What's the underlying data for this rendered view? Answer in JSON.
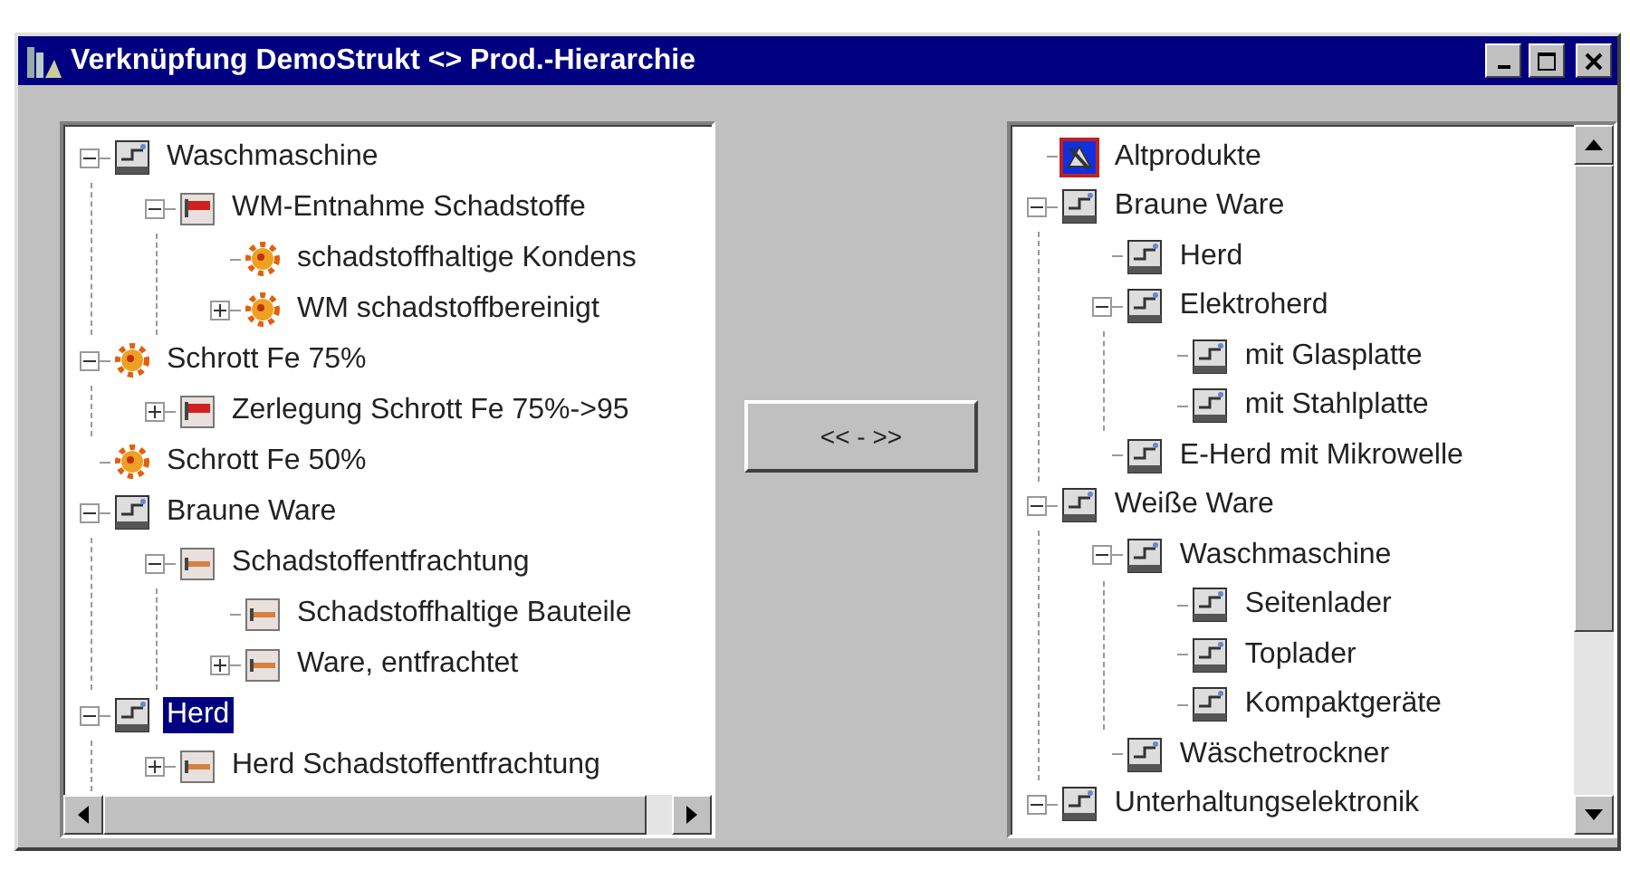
{
  "window": {
    "title": "Verknüpfung DemoStrukt <> Prod.-Hierarchie"
  },
  "left_tree": [
    {
      "label": "Waschmaschine",
      "kind": "machine",
      "expanded": true,
      "selected": false,
      "children": [
        {
          "label": "WM-Entnahme Schadstoffe",
          "kind": "flag",
          "expanded": true,
          "selected": false,
          "children": [
            {
              "label": "schadstoffhaltige Kondens",
              "kind": "gear",
              "selected": false
            },
            {
              "label": "WM schadstoffbereinigt",
              "kind": "gear",
              "expanded": false,
              "selected": false
            }
          ]
        }
      ]
    },
    {
      "label": "Schrott Fe 75%",
      "kind": "gear",
      "expanded": true,
      "selected": false,
      "children": [
        {
          "label": "Zerlegung Schrott Fe 75%->95",
          "kind": "flag",
          "expanded": false,
          "selected": false
        }
      ]
    },
    {
      "label": "Schrott Fe 50%",
      "kind": "gear",
      "selected": false
    },
    {
      "label": "Braune Ware",
      "kind": "machine",
      "expanded": true,
      "selected": false,
      "children": [
        {
          "label": "Schadstoffentfrachtung",
          "kind": "bar",
          "expanded": true,
          "selected": false,
          "children": [
            {
              "label": "Schadstoffhaltige Bauteile",
              "kind": "bar",
              "selected": false
            },
            {
              "label": "Ware, entfrachtet",
              "kind": "bar",
              "expanded": false,
              "selected": false
            }
          ]
        }
      ]
    },
    {
      "label": "Herd",
      "kind": "machine",
      "expanded": true,
      "selected": true,
      "children": [
        {
          "label": "Herd Schadstoffentfrachtung",
          "kind": "bar",
          "expanded": false,
          "selected": false
        }
      ]
    }
  ],
  "swap_button": "<< - >>",
  "right_tree": [
    {
      "label": "Altprodukte",
      "kind": "alt",
      "selected": false
    },
    {
      "label": "Braune Ware",
      "kind": "machine",
      "expanded": true,
      "selected": false,
      "children": [
        {
          "label": "Herd",
          "kind": "machine",
          "selected": false
        },
        {
          "label": "Elektroherd",
          "kind": "machine",
          "expanded": true,
          "selected": false,
          "children": [
            {
              "label": "mit Glasplatte",
              "kind": "machine",
              "selected": false
            },
            {
              "label": "mit Stahlplatte",
              "kind": "machine",
              "selected": false
            }
          ]
        },
        {
          "label": "E-Herd mit Mikrowelle",
          "kind": "machine",
          "selected": false
        }
      ]
    },
    {
      "label": "Weiße Ware",
      "kind": "machine",
      "expanded": true,
      "selected": false,
      "children": [
        {
          "label": "Waschmaschine",
          "kind": "machine",
          "expanded": true,
          "selected": false,
          "children": [
            {
              "label": "Seitenlader",
              "kind": "machine",
              "selected": false
            },
            {
              "label": "Toplader",
              "kind": "machine",
              "selected": false
            },
            {
              "label": "Kompaktgeräte",
              "kind": "machine",
              "selected": false
            }
          ]
        },
        {
          "label": "Wäschetrockner",
          "kind": "machine",
          "selected": false
        }
      ]
    },
    {
      "label": "Unterhaltungselektronik",
      "kind": "machine",
      "expanded": true,
      "selected": false
    }
  ]
}
